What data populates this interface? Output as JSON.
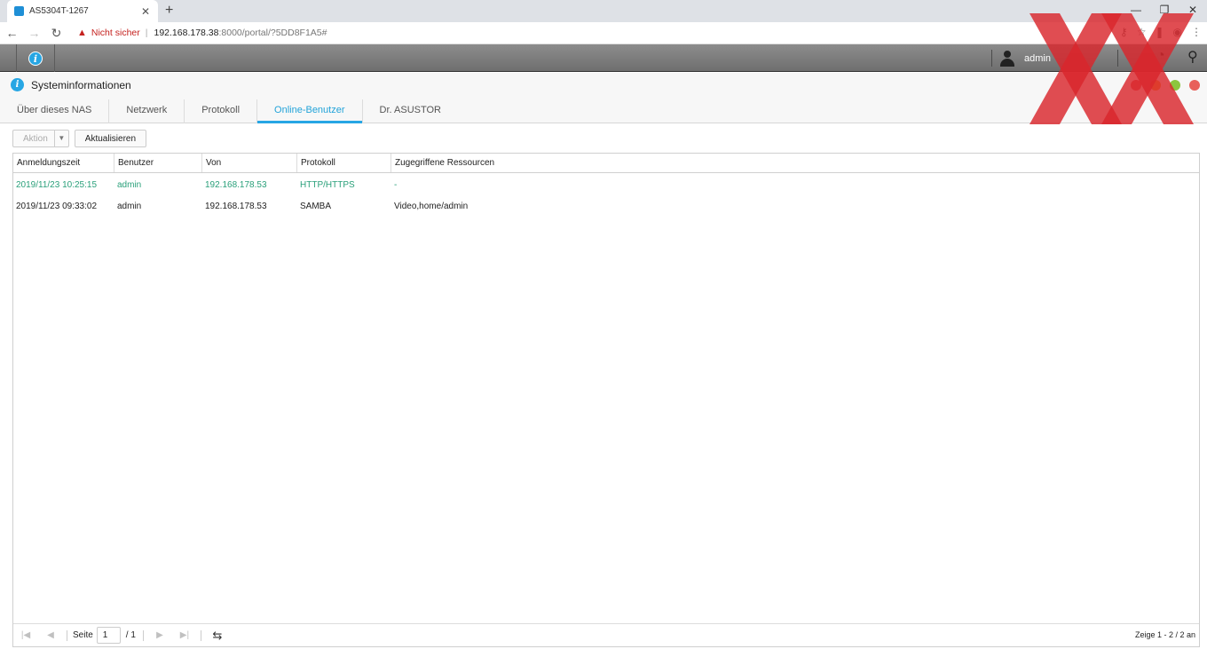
{
  "browser": {
    "tab_title": "AS5304T-1267",
    "new_tab": "+",
    "tab_close": "✕",
    "insecure_label": "Nicht sicher",
    "url_host": "192.168.178.38",
    "url_path": ":8000/portal/?5DD8F1A5#",
    "window_controls": [
      "—",
      "❐",
      "✕"
    ]
  },
  "adm": {
    "username": "admin"
  },
  "window": {
    "title": "Systeminformationen",
    "dot_colors": [
      "#e05a5a",
      "#f0a030",
      "#8cc63e",
      "#e8605a"
    ],
    "tabs": [
      {
        "label": "Über dieses NAS",
        "active": false
      },
      {
        "label": "Netzwerk",
        "active": false
      },
      {
        "label": "Protokoll",
        "active": false
      },
      {
        "label": "Online-Benutzer",
        "active": true
      },
      {
        "label": "Dr. ASUSTOR",
        "active": false
      }
    ]
  },
  "toolbar": {
    "action_label": "Aktion",
    "refresh_label": "Aktualisieren"
  },
  "grid": {
    "columns": [
      "Anmeldungszeit",
      "Benutzer",
      "Von",
      "Protokoll",
      "Zugegriffene Ressourcen"
    ],
    "rows": [
      {
        "time": "2019/11/23 10:25:15",
        "user": "admin",
        "from": "192.168.178.53",
        "protocol": "HTTP/HTTPS",
        "resources": "-",
        "highlight": true
      },
      {
        "time": "2019/11/23 09:33:02",
        "user": "admin",
        "from": "192.168.178.53",
        "protocol": "SAMBA",
        "resources": "Video,home/admin",
        "highlight": false
      }
    ],
    "highlight_color": "#2aa07a"
  },
  "pager": {
    "page_label": "Seite",
    "page_value": "1",
    "total": "/ 1",
    "info": "Zeige 1 - 2 / 2 an"
  },
  "colors": {
    "accent": "#27a6e4",
    "watermark": "#d9262c"
  }
}
